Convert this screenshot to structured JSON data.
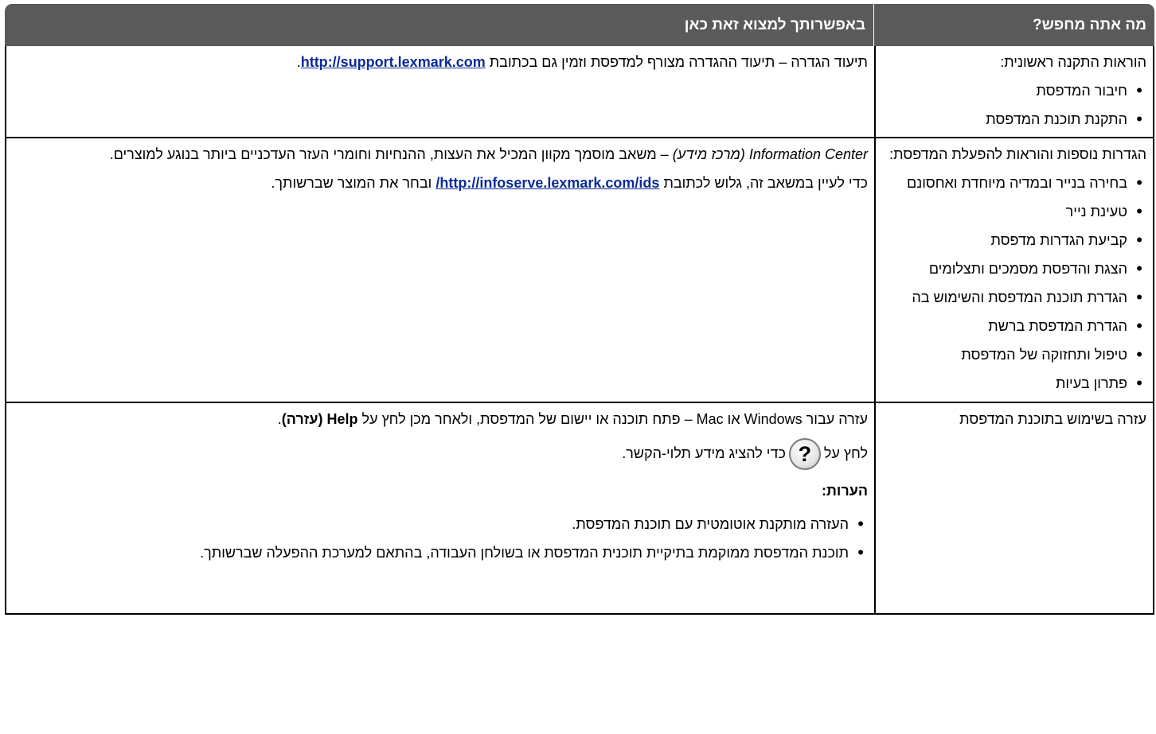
{
  "header": {
    "col_looking": "מה אתה מחפש?",
    "col_find": "באפשרותך למצוא זאת כאן"
  },
  "rows": [
    {
      "left_title": "הוראות התקנה ראשונית:",
      "left_items": [
        "חיבור המדפסת",
        "התקנת תוכנת המדפסת"
      ],
      "p1_text": "תיעוד הגדרה – תיעוד ההגדרה מצורף למדפסת וזמין גם בכתובת",
      "p1_link": "http://support.lexmark.com",
      "p1_end": "."
    },
    {
      "left_title": "הגדרות נוספות והוראות להפעלת המדפסת:",
      "left_items": [
        "בחירה בנייר ובמדיה מיוחדת ואחסונם",
        "טעינת נייר",
        "קביעת הגדרות מדפסת",
        "הצגת והדפסת מסמכים ותצלומים",
        "הגדרת תוכנת המדפסת והשימוש בה",
        "הגדרת המדפסת ברשת",
        "טיפול ותחזוקה של המדפסת",
        "פתרון בעיות"
      ],
      "p1_italic": "Information Center (מרכז מידע)",
      "p1_text": "– משאב מוסמך מקוון המכיל את העצות, ההנחיות וחומרי העזר העדכניים ביותר בנוגע למוצרים.",
      "p2_text": "כדי לעיין במשאב זה, גלוש לכתובת",
      "p2_link": "http://infoserve.lexmark.com/ids/",
      "p2_end": "ובחר את המוצר שברשותך."
    },
    {
      "left_title": "עזרה בשימוש בתוכנת המדפסת",
      "p1_text": "עזרה עבור Windows או Mac – פתח תוכנה או יישום של המדפסת, ולאחר מכן לחץ על",
      "p1_bold": "Help (עזרה)",
      "p1_end": ".",
      "p2_pre": "לחץ על",
      "p2_icon": "?",
      "p2_post": "כדי להציג מידע תלוי-הקשר.",
      "notes_title": "הערות:",
      "notes": [
        "העזרה מותקנת אוטומטית עם תוכנת המדפסת.",
        "תוכנת המדפסת ממוקמת בתיקיית תוכנית המדפסת או בשולחן העבודה, בהתאם למערכת ההפעלה שברשותך."
      ]
    }
  ]
}
